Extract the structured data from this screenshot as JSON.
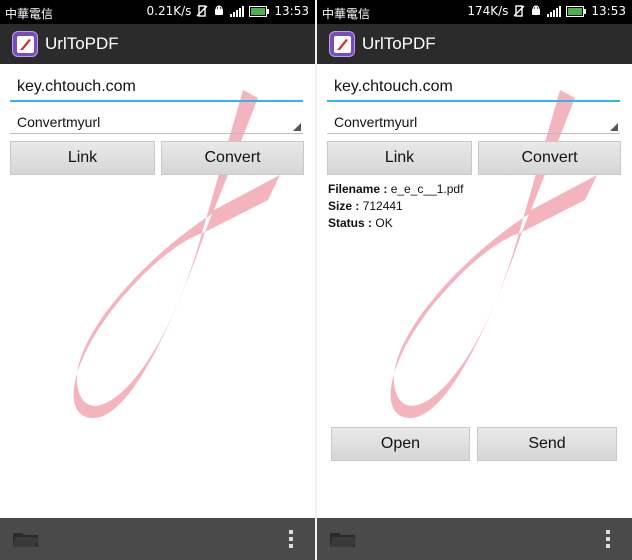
{
  "screens": [
    {
      "status_bar": {
        "carrier": "中華電信",
        "speed": "0.21K/s",
        "time": "13:53"
      },
      "app_title": "UrlToPDF",
      "url_input": "key.chtouch.com",
      "spinner_value": "Convertmyurl",
      "buttons": {
        "link": "Link",
        "convert": "Convert"
      }
    },
    {
      "status_bar": {
        "carrier": "中華電信",
        "speed": "174K/s",
        "time": "13:53"
      },
      "app_title": "UrlToPDF",
      "url_input": "key.chtouch.com",
      "spinner_value": "Convertmyurl",
      "buttons": {
        "link": "Link",
        "convert": "Convert",
        "open": "Open",
        "send": "Send"
      },
      "result": {
        "filename_label": "Filename :",
        "filename_value": "e_e_c__1.pdf",
        "size_label": "Size :",
        "size_value": "712441",
        "status_label": "Status :",
        "status_value": "OK"
      }
    }
  ],
  "icons": [
    "app-icon",
    "vibrate-off-icon",
    "android-icon",
    "signal-icon",
    "battery-icon",
    "folder-icon",
    "overflow-menu-icon"
  ],
  "colors": {
    "accent": "#33b5e5",
    "watermark": "#f2a7b3",
    "action_bar": "#2b2b2b",
    "bottom_bar": "#4a4a4a"
  }
}
